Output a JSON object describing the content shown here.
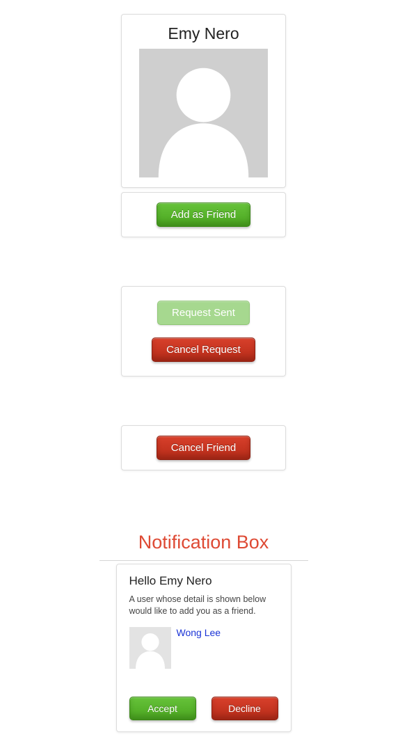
{
  "profile": {
    "name": "Emy Nero"
  },
  "buttons": {
    "add_friend": "Add as Friend",
    "request_sent": "Request Sent",
    "cancel_request": "Cancel Request",
    "cancel_friend": "Cancel Friend",
    "accept": "Accept",
    "decline": "Decline"
  },
  "notification": {
    "section_title": "Notification Box",
    "greeting": "Hello Emy Nero",
    "detail": "A user whose detail is shown below would like to add you as a friend.",
    "requester_name": "Wong Lee"
  }
}
